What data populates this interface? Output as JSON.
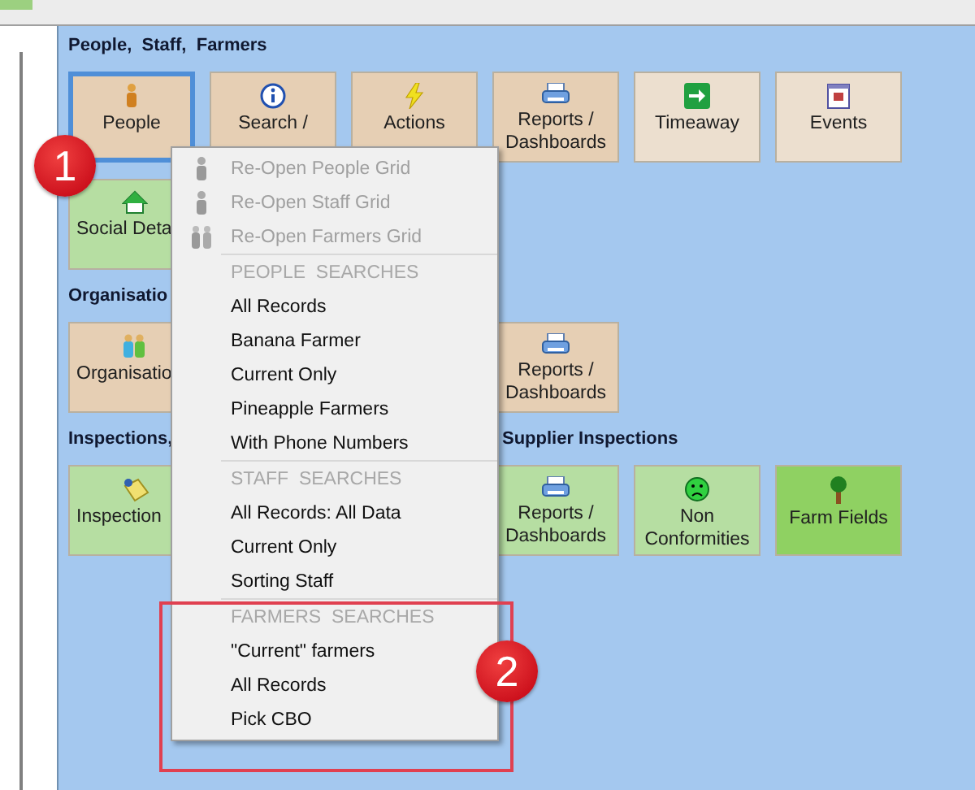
{
  "sections": [
    {
      "title": "People,  Staff,  Farmers",
      "rows": [
        [
          {
            "kind": "tile",
            "label": "People",
            "color": "#e6cfb4",
            "selected": true
          },
          {
            "kind": "tile",
            "label": "Search /",
            "color": "#e6cfb4",
            "selected": false
          },
          {
            "kind": "tile",
            "label": "Actions",
            "color": "#e6cfb4",
            "selected": false
          },
          {
            "kind": "tile",
            "label": "Reports / Dashboards",
            "color": "#e6cfb4",
            "selected": false
          },
          {
            "kind": "tile",
            "label": "Timeaway",
            "color": "#ecdfcf",
            "selected": false
          },
          {
            "kind": "tile",
            "label": "Events",
            "color": "#ecdfcf",
            "selected": false
          }
        ],
        [
          {
            "kind": "cut-tile",
            "label": "Social Deta",
            "color": "#b6dea2",
            "selected": false
          }
        ]
      ]
    },
    {
      "title": "Organisatio",
      "rows": [
        [
          {
            "kind": "cut-tile",
            "label": "Organisatio",
            "color": "#e6cfb4",
            "selected": false
          },
          {
            "kind": "tile",
            "label": "Reports / Dashboards",
            "color": "#e6cfb4",
            "selected": false
          }
        ]
      ]
    },
    {
      "title": "Inspections,",
      "rows": [
        [
          {
            "kind": "cut-tile",
            "label": "Inspection",
            "color": "#b6dea2",
            "selected": false
          }
        ]
      ]
    },
    {
      "title": "Supplier Inspections",
      "rows": [
        [
          {
            "kind": "tile",
            "label": "Reports / Dashboards",
            "color": "#b6dea2",
            "selected": false
          },
          {
            "kind": "tile",
            "label": "Non Conformities",
            "color": "#b6dea2",
            "selected": false
          },
          {
            "kind": "tile",
            "label": "Farm Fields",
            "color": "#8fd162",
            "selected": false
          }
        ]
      ]
    }
  ],
  "menu": [
    {
      "kind": "item",
      "label": "Re-Open People Grid",
      "disabled": true
    },
    {
      "kind": "item",
      "label": "Re-Open Staff Grid",
      "disabled": true
    },
    {
      "kind": "item",
      "label": "Re-Open Farmers Grid",
      "disabled": true
    },
    {
      "kind": "header",
      "label": "PEOPLE  SEARCHES"
    },
    {
      "kind": "item",
      "label": "All Records",
      "disabled": false
    },
    {
      "kind": "item",
      "label": "Banana Farmer",
      "disabled": false
    },
    {
      "kind": "item",
      "label": "Current Only",
      "disabled": false
    },
    {
      "kind": "item",
      "label": "Pineapple Farmers",
      "disabled": false
    },
    {
      "kind": "item",
      "label": "With Phone Numbers",
      "disabled": false
    },
    {
      "kind": "header",
      "label": "STAFF  SEARCHES"
    },
    {
      "kind": "item",
      "label": "All Records: All Data",
      "disabled": false
    },
    {
      "kind": "item",
      "label": "Current Only",
      "disabled": false
    },
    {
      "kind": "item",
      "label": "Sorting Staff",
      "disabled": false
    },
    {
      "kind": "header",
      "label": "FARMERS  SEARCHES"
    },
    {
      "kind": "item",
      "label": "\"Current\" farmers",
      "disabled": false
    },
    {
      "kind": "item",
      "label": "All Records",
      "disabled": false
    },
    {
      "kind": "item",
      "label": "Pick CBO",
      "disabled": false
    }
  ],
  "callouts": [
    "1",
    "2"
  ]
}
